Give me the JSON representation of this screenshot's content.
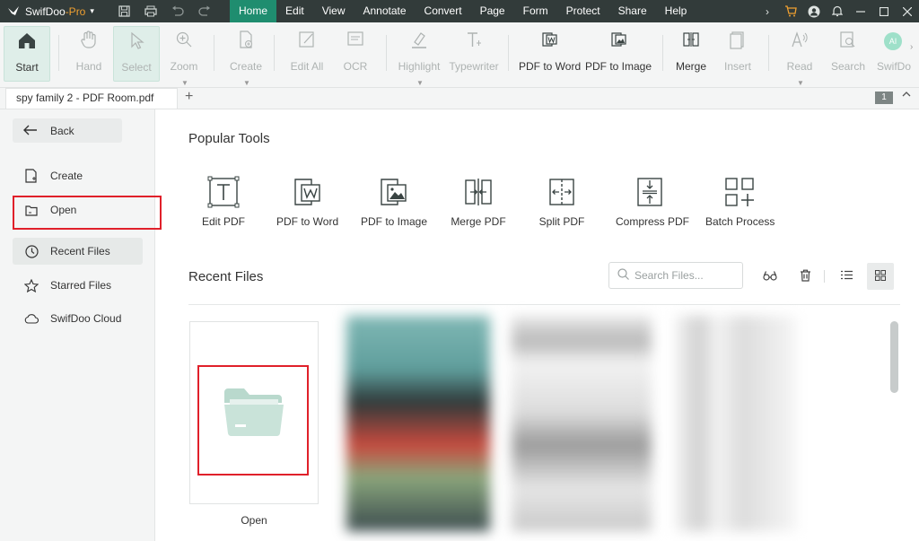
{
  "app": {
    "name": "SwifDoo",
    "edition": "-Pro",
    "dropdown_arrow": "▾"
  },
  "menu": [
    "Home",
    "Edit",
    "View",
    "Annotate",
    "Convert",
    "Page",
    "Form",
    "Protect",
    "Share",
    "Help"
  ],
  "ribbon": {
    "start": "Start",
    "hand": "Hand",
    "select": "Select",
    "zoom": "Zoom",
    "create": "Create",
    "edit_all": "Edit All",
    "ocr": "OCR",
    "highlight": "Highlight",
    "typewriter": "Typewriter",
    "pdf_to_word": "PDF to Word",
    "pdf_to_image": "PDF to Image",
    "merge": "Merge",
    "insert": "Insert",
    "read": "Read",
    "search": "Search",
    "swifdoo_ai": "SwifDo",
    "ai_badge": "AI"
  },
  "document_tab": {
    "title": "spy family 2 - PDF Room.pdf",
    "add": "+",
    "page_badge": "1"
  },
  "sidebar": {
    "back": "Back",
    "items": [
      "Create",
      "Open",
      "Recent Files",
      "Starred Files",
      "SwifDoo Cloud"
    ]
  },
  "popular_tools": {
    "title": "Popular Tools",
    "items": [
      "Edit PDF",
      "PDF to Word",
      "PDF to Image",
      "Merge PDF",
      "Split PDF",
      "Compress PDF",
      "Batch Process"
    ]
  },
  "recent_files": {
    "title": "Recent Files",
    "search_placeholder": "Search Files...",
    "open_card_label": "Open"
  },
  "colors": {
    "accent": "#1f8d6f",
    "titlebar": "#323b3a",
    "highlight_box": "#e0202a"
  }
}
